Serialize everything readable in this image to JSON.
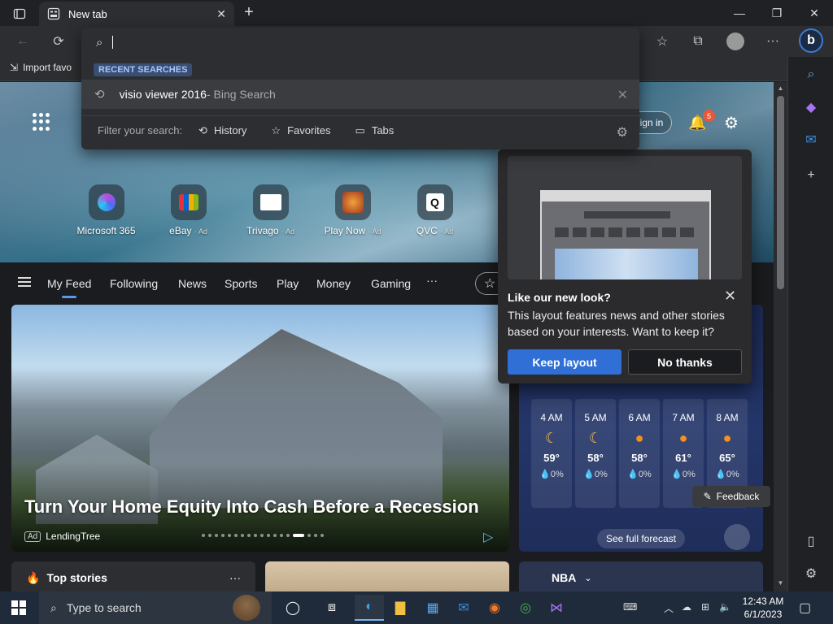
{
  "browser": {
    "tab_title": "New tab",
    "favorites_import_label": "Import favo"
  },
  "address_dropdown": {
    "section_label": "RECENT SEARCHES",
    "recent_item": {
      "query": "visio viewer 2016",
      "suffix": " - Bing Search"
    },
    "filter_label": "Filter your search:",
    "filters": [
      {
        "label": "History"
      },
      {
        "label": "Favorites"
      },
      {
        "label": "Tabs"
      }
    ]
  },
  "header": {
    "signin_label": "Sign in",
    "notification_count": "5"
  },
  "quick_links": [
    {
      "label": "Microsoft 365",
      "ad": ""
    },
    {
      "label": "eBay",
      "ad": "· Ad"
    },
    {
      "label": "Trivago",
      "ad": "· Ad"
    },
    {
      "label": "Play Now",
      "ad": "· Ad"
    },
    {
      "label": "QVC",
      "ad": "· Ad"
    }
  ],
  "feed_nav": {
    "tabs": [
      "My Feed",
      "Following",
      "News",
      "Sports",
      "Play",
      "Money",
      "Gaming"
    ],
    "more": "···"
  },
  "hero": {
    "title": "Turn Your Home Equity Into Cash Before a Recession",
    "ad_badge": "Ad",
    "source": "LendingTree"
  },
  "popup": {
    "title": "Like our new look?",
    "text": "This layout features news and other stories based on your interests. Want to keep it?",
    "keep_label": "Keep layout",
    "no_label": "No thanks"
  },
  "weather": {
    "hours": [
      {
        "time": "4 AM",
        "icon": "moon-icon",
        "temp": "59°",
        "precip": "0%"
      },
      {
        "time": "5 AM",
        "icon": "moon-icon",
        "temp": "58°",
        "precip": "0%"
      },
      {
        "time": "6 AM",
        "icon": "sun-icon",
        "temp": "58°",
        "precip": "0%"
      },
      {
        "time": "7 AM",
        "icon": "sun-icon",
        "temp": "61°",
        "precip": "0%"
      },
      {
        "time": "8 AM",
        "icon": "sun-icon",
        "temp": "65°",
        "precip": "0%"
      }
    ],
    "forecast_label": "See full forecast"
  },
  "bottom": {
    "top_stories_label": "Top stories",
    "top_stories_more": "···",
    "nba_label": "NBA",
    "feedback_label": "Feedback"
  },
  "taskbar": {
    "search_placeholder": "Type to search",
    "time": "12:43 AM",
    "date": "6/1/2023"
  },
  "colors": {
    "accent": "#2f6fd6",
    "badge": "#e8593a",
    "feed_underline": "#5a9be6"
  }
}
